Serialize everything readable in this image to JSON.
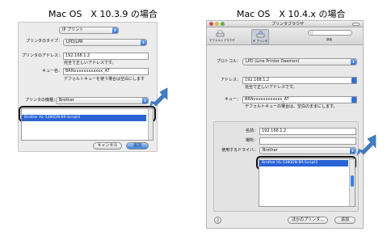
{
  "left": {
    "title": "Mac OS　X 10.3.9 の場合",
    "protocol_popup": "IP プリント",
    "printer_type_label": "プリンタのタイプ：",
    "printer_type_value": "LPD/LPR",
    "address_label": "プリンタのアドレス：",
    "address_value": "192.168.1.2",
    "address_note": "完全で正しいアドレスです。",
    "queue_label": "キュー名：",
    "queue_value": "BRNxxxxxxxxxxxx_AT",
    "queue_note": "デフォルトキューを使う場合は空白にします",
    "model_label": "プリンタの機種：",
    "model_value": "Brother",
    "selected_driver": "Brother HL-5380DN BR-Script3",
    "cancel_label": "キャンセル",
    "add_label": "追加"
  },
  "right": {
    "title": "Mac OS　X 10.4.x の場合",
    "window_title": "プリンタブラウザ",
    "toolbar_default": "デフォルトブラウザ",
    "toolbar_ip": "IP プリンタ",
    "search_placeholder": "Q",
    "search_caption": "検索",
    "protocol_label": "プロトコル：",
    "protocol_value": "LPD (Line Printer Daemon)",
    "address_label": "アドレス：",
    "address_value": "192.168.1.2",
    "address_note": "完全で正しいアドレスです。",
    "queue_label": "キュー：",
    "queue_value": "BRNxxxxxxxxxxxx_AT",
    "queue_note": "デフォルトキューの場合は、空白のままにします。",
    "name_label": "名前：",
    "name_value": "192.168.1.2",
    "location_label": "場所：",
    "driver_label": "使用するドライバ：",
    "driver_value": "Brother",
    "selected_driver": "Brother HL-5380DN BR-Script3",
    "help_label": "?",
    "more_printers_label": "ほかのプリンタ...",
    "add_label": "追加"
  },
  "colors": {
    "arrow": "#3f7fc8",
    "selection": "#2a63d6"
  }
}
